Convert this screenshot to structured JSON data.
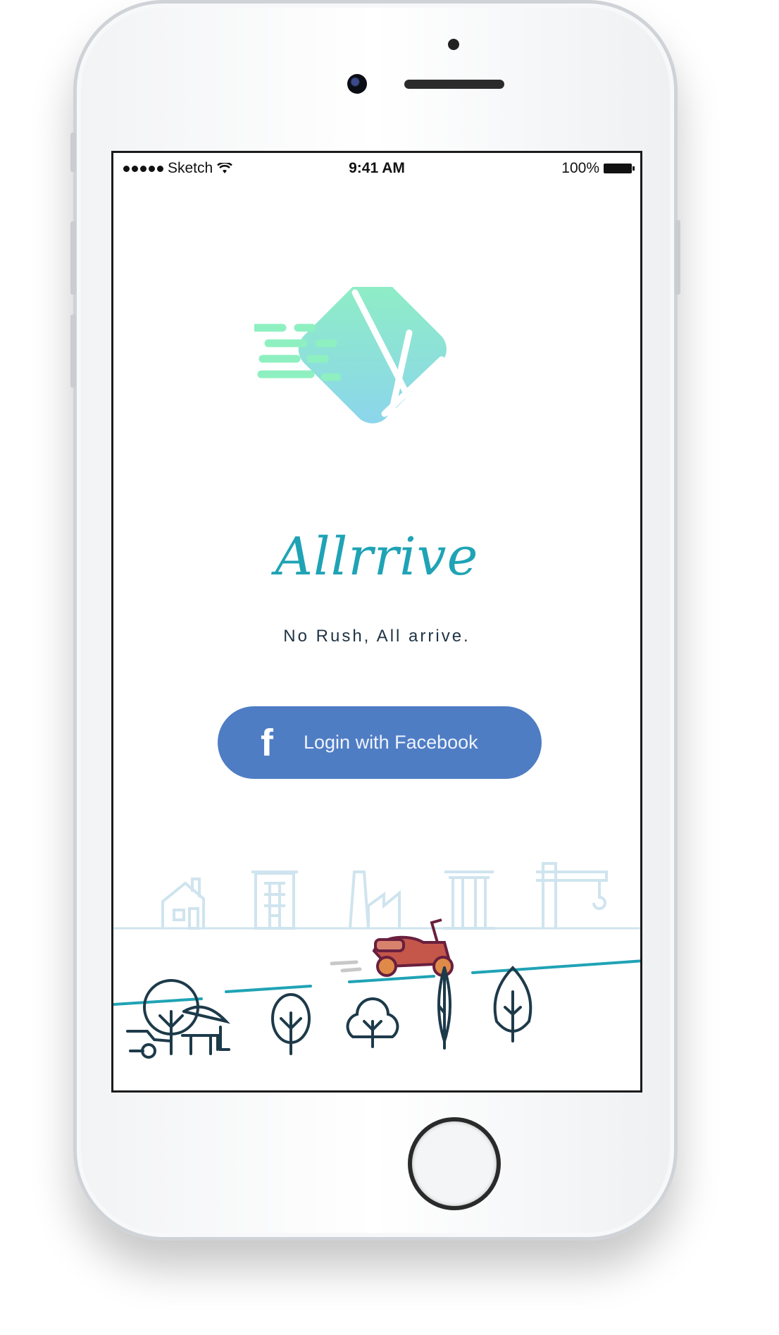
{
  "status_bar": {
    "carrier": "Sketch",
    "time": "9:41 AM",
    "battery": "100%"
  },
  "app": {
    "name": "Allrrive",
    "tagline": "No Rush, All arrive."
  },
  "login": {
    "facebook_label": "Login with Facebook",
    "facebook_icon": "f"
  },
  "colors": {
    "brand": "#1fa3b5",
    "facebook": "#4f7dc4",
    "logo_gradient_start": "#8ef0c0",
    "logo_gradient_end": "#8cd4ee",
    "scooter": "#c4564a"
  }
}
